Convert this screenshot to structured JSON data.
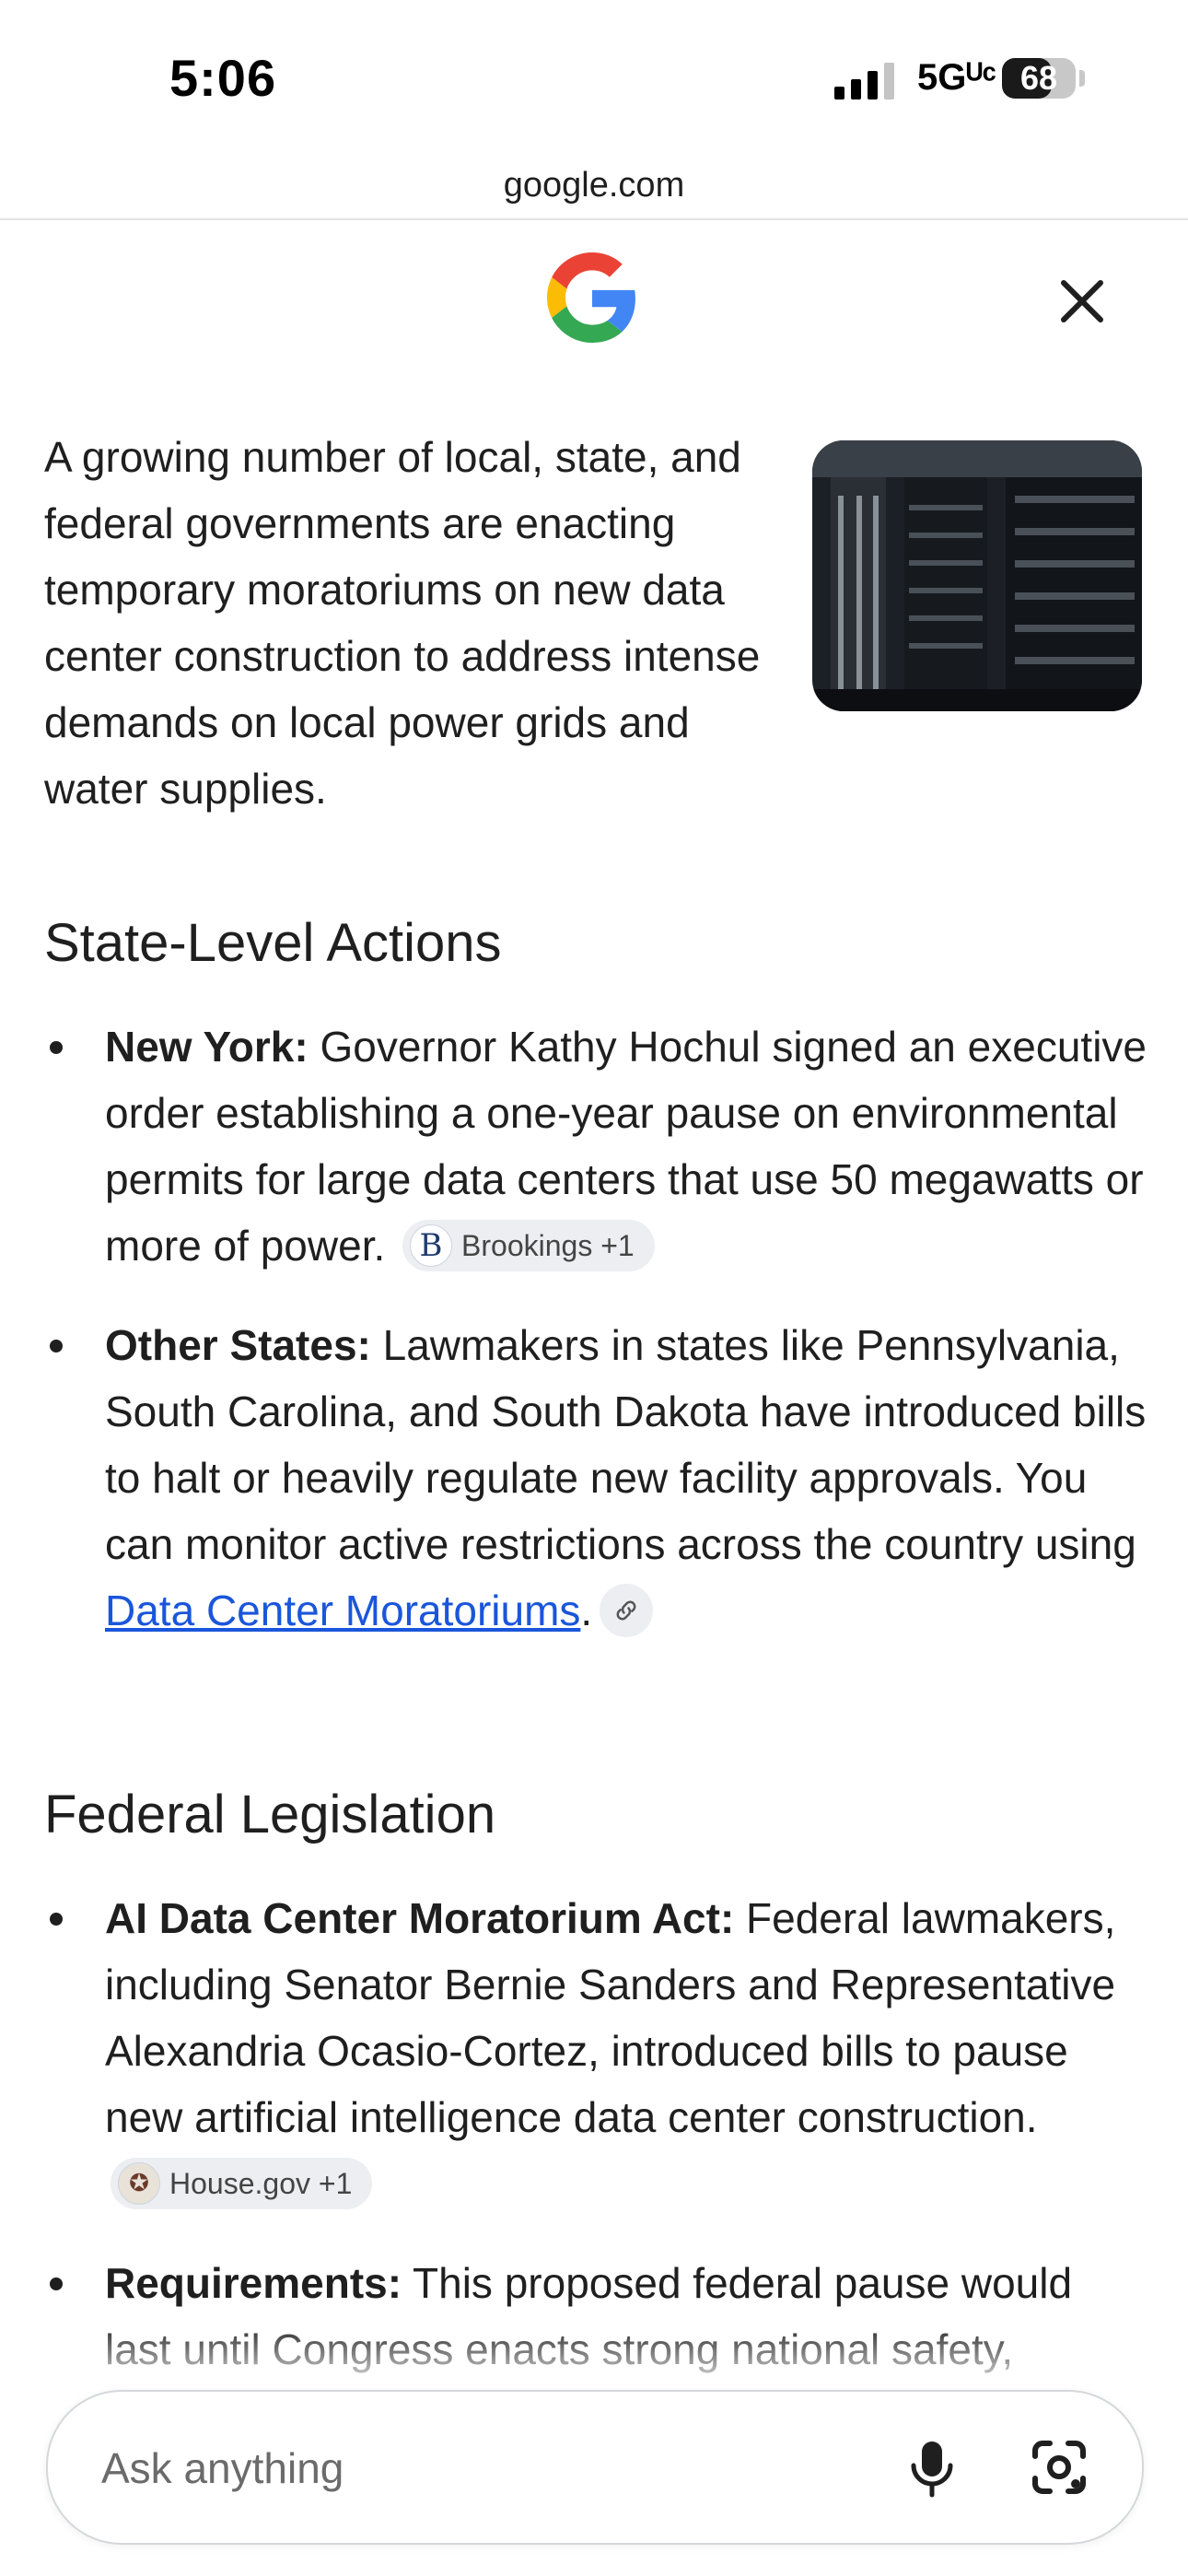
{
  "status_bar": {
    "time": "5:06",
    "network": "5Gᵁᶜ",
    "battery": "68",
    "battery_level": 0.68
  },
  "browser": {
    "url": "google.com"
  },
  "overlay": {
    "logo": "google-g-logo",
    "close_icon": "close-icon"
  },
  "intro": {
    "text": "A growing number of local, state, and federal governments are enacting temporary moratoriums on new data center construction to address intense demands on local power grids and water supplies.",
    "image": "server-rack-photo"
  },
  "sections": [
    {
      "heading": "State-Level Actions",
      "items": [
        {
          "label": "New York:",
          "text": " Governor Kathy Hochul signed an executive order establishing a one-year pause on environmental permits for large data centers that use 50 megawatts or more of power. ",
          "source_chip": {
            "icon_letter": "B",
            "text": "Brookings +1"
          }
        },
        {
          "label": "Other States:",
          "text": " Lawmakers in states like Pennsylvania, South Carolina, and South Dakota have introduced bills to halt or heavily regulate new facility approvals. You can monitor active restrictions across the country using ",
          "link": "Data Center Moratoriums",
          "after_link": ".",
          "link_icon": "link-icon"
        }
      ]
    },
    {
      "heading": "Federal Legislation",
      "items": [
        {
          "label": "AI Data Center Moratorium Act:",
          "text": " Federal lawmakers, including Senator Bernie Sanders and Representative Alexandria Ocasio-Cortez, introduced bills to pause new artificial intelligence data center construction. ",
          "source_chip": {
            "icon_letter": "",
            "text": "House.gov +1"
          }
        },
        {
          "label": "Requirements:",
          "text": " This proposed federal pause would last until Congress enacts strong national safety,"
        }
      ]
    }
  ],
  "ask_bar": {
    "placeholder": "Ask anything",
    "mic_icon": "microphone-icon",
    "lens_icon": "camera-lens-icon"
  }
}
